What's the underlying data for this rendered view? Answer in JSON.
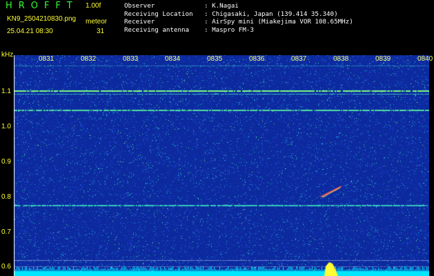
{
  "header": {
    "title": "HROFFT",
    "version": "1.00f",
    "filename": "KN9_2504210830.png",
    "datetime": "25.04.21 08:30",
    "meteor_label": "meteor",
    "meteor_count": "31"
  },
  "station": [
    {
      "key": "Observer",
      "value": "K.Nagai"
    },
    {
      "key": "Receiving Location",
      "value": "Chigasaki, Japan (139.414 35.340)"
    },
    {
      "key": "Receiver",
      "value": "AirSpy mini (Miakejima VOR 108.65MHz)"
    },
    {
      "key": "Receiving antenna",
      "value": "Maspro FM-3"
    }
  ],
  "chart_data": {
    "type": "heatmap",
    "ylabel": "kHz",
    "y_ticks": [
      "1.1",
      "1.0",
      "0.9",
      "0.8",
      "0.7",
      "0.6"
    ],
    "x_ticks": [
      "0831",
      "0832",
      "0833",
      "0834",
      "0835",
      "0836",
      "0837",
      "0838",
      "0839",
      "0840"
    ],
    "ylim": [
      0.575,
      1.205
    ],
    "colors": {
      "background": "#0c2a9e",
      "noise": "#2ee8c8",
      "line": "#56ffa0",
      "signal": "#ffff33",
      "bottom": "#00e6ff"
    }
  }
}
